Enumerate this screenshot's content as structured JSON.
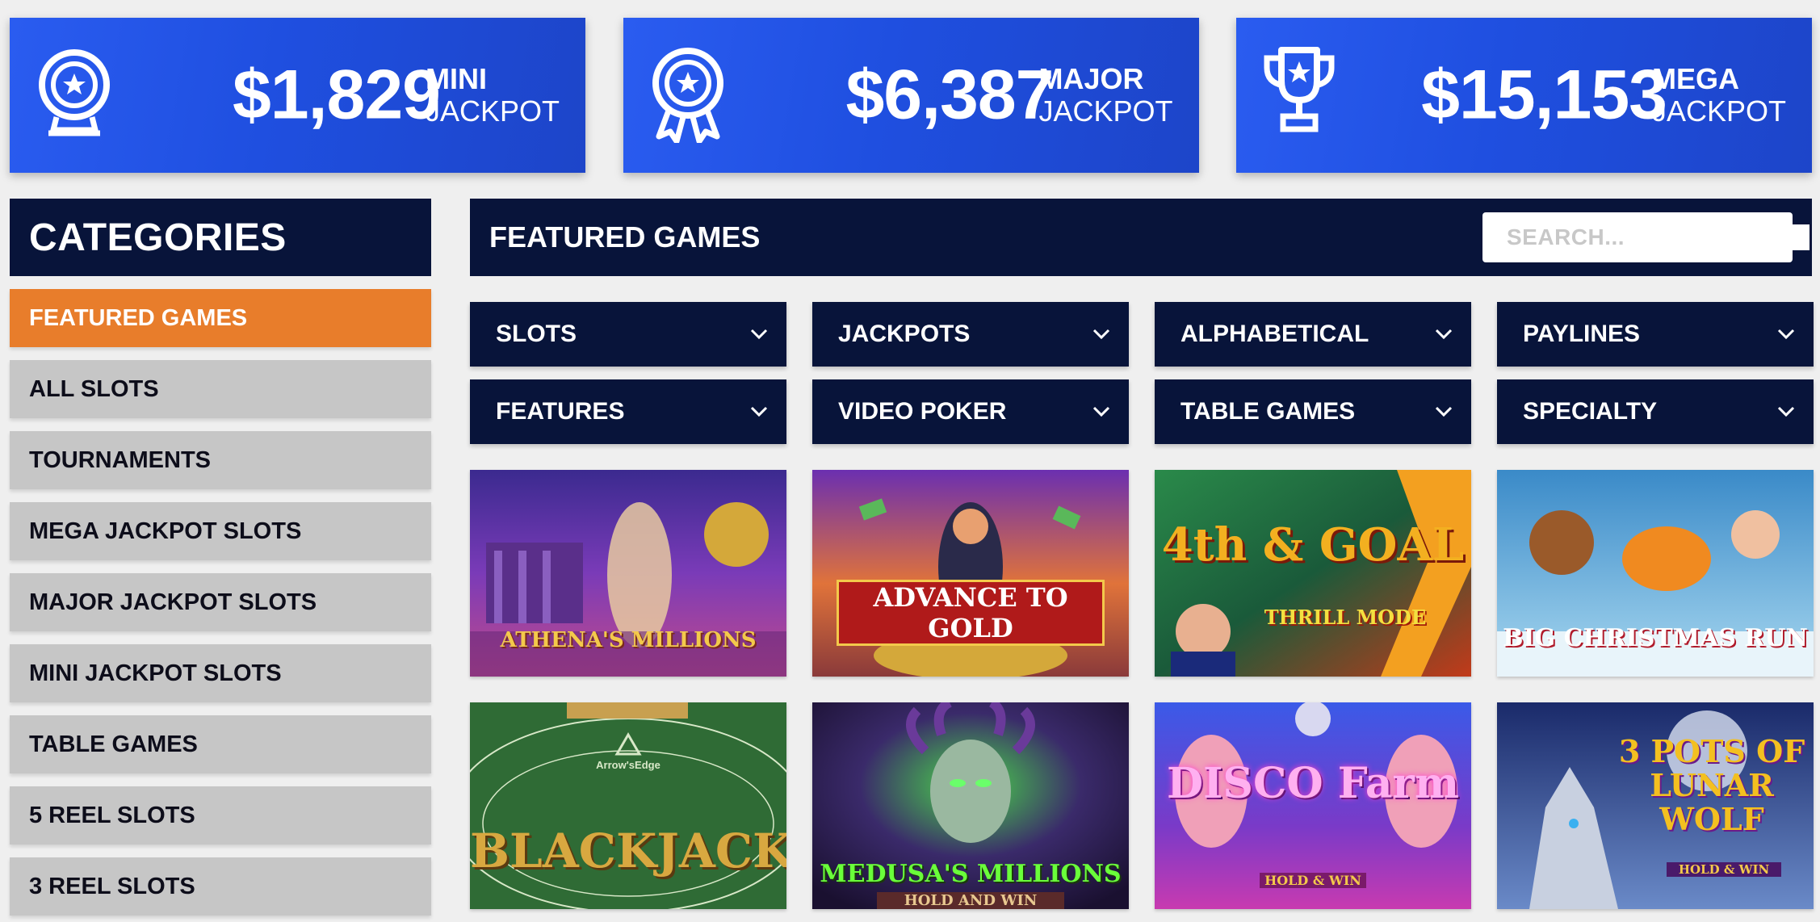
{
  "jackpots": [
    {
      "amount": "$1,829",
      "label_top": "MINI",
      "label_bottom": "JACKPOT",
      "icon": "globe-star-icon"
    },
    {
      "amount": "$6,387",
      "label_top": "MAJOR",
      "label_bottom": "JACKPOT",
      "icon": "ribbon-medal-icon"
    },
    {
      "amount": "$15,153",
      "label_top": "MEGA",
      "label_bottom": "JACKPOT",
      "icon": "trophy-icon"
    }
  ],
  "sidebar": {
    "title": "CATEGORIES",
    "items": [
      {
        "label": "FEATURED GAMES",
        "active": true
      },
      {
        "label": "ALL SLOTS"
      },
      {
        "label": "TOURNAMENTS"
      },
      {
        "label": "MEGA JACKPOT SLOTS"
      },
      {
        "label": "MAJOR JACKPOT SLOTS"
      },
      {
        "label": "MINI JACKPOT SLOTS"
      },
      {
        "label": "TABLE GAMES"
      },
      {
        "label": "5 REEL SLOTS"
      },
      {
        "label": "3 REEL SLOTS"
      }
    ]
  },
  "main": {
    "title": "FEATURED GAMES",
    "search": {
      "placeholder": "SEARCH...",
      "value": ""
    },
    "filters": [
      "SLOTS",
      "JACKPOTS",
      "ALPHABETICAL",
      "PAYLINES",
      "FEATURES",
      "VIDEO POKER",
      "TABLE GAMES",
      "SPECIALTY"
    ],
    "games": [
      {
        "title": "ATHENA'S MILLIONS"
      },
      {
        "title": "ADVANCE TO GOLD"
      },
      {
        "title": "4th & GOAL",
        "subtitle": "THRILL MODE"
      },
      {
        "title": "BIG CHRISTMAS RUN"
      },
      {
        "title": "BLACKJACK",
        "subtitle": "Arrow'sEdge"
      },
      {
        "title": "MEDUSA'S MILLIONS",
        "subtitle": "HOLD AND WIN"
      },
      {
        "title": "DISCO Farm",
        "subtitle": "HOLD & WIN"
      },
      {
        "title": "3 POTS OF LUNAR WOLF",
        "subtitle": "HOLD & WIN"
      }
    ]
  },
  "colors": {
    "navy": "#08143a",
    "accent_orange": "#e87d2b",
    "jackpot_blue": "#2a5cf0",
    "item_gray": "#c6c6c6"
  }
}
